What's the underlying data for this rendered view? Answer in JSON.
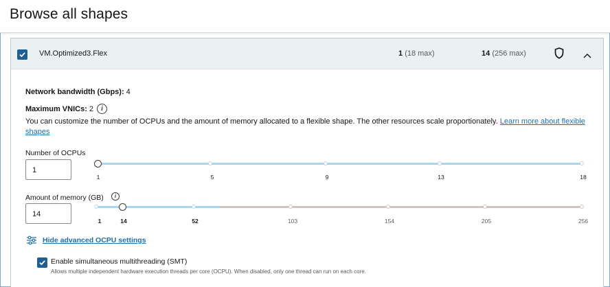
{
  "page": {
    "title": "Browse all shapes"
  },
  "shape_row": {
    "checked": true,
    "name": "VM.Optimized3.Flex",
    "ocpu_value": "1",
    "ocpu_max": "(18 max)",
    "memory_value": "14",
    "memory_max": "(256 max)",
    "icons": {
      "security": "shield-icon",
      "collapse": "chevron-up-icon"
    }
  },
  "details": {
    "network_label": "Network bandwidth (Gbps):",
    "network_value": "4",
    "vnics_label": "Maximum VNICs:",
    "vnics_value": "2",
    "info_glyph": "i",
    "description": "You can customize the number of OCPUs and the amount of memory allocated to a flexible shape. The other resources scale proportionately.",
    "learn_more_link": "Learn more about flexible shapes"
  },
  "ocpu_slider": {
    "label": "Number of OCPUs",
    "value": "1",
    "min": 1,
    "max": 18,
    "ticks": [
      "1",
      "5",
      "9",
      "13",
      "18"
    ]
  },
  "memory_slider": {
    "label": "Amount of memory (GB)",
    "value": "14",
    "min": 1,
    "max": 256,
    "allowed_max": 52,
    "ticks": [
      "1",
      "14",
      "52",
      "103",
      "154",
      "205",
      "256"
    ]
  },
  "advanced": {
    "link": "Hide advanced OCPU settings",
    "icon": "sliders-icon"
  },
  "smt": {
    "checked": true,
    "label": "Enable simultaneous multithreading (SMT)",
    "help": "Allows multiple independent hardware execution threads per core (OCPU). When disabled, only one thread can run on each core."
  },
  "colors": {
    "accent": "#1f5f93",
    "link": "#1f6ea8",
    "track_active": "#a9d6ee",
    "track_inactive": "#cfc6c3",
    "header_bg": "#eaf1f2"
  }
}
